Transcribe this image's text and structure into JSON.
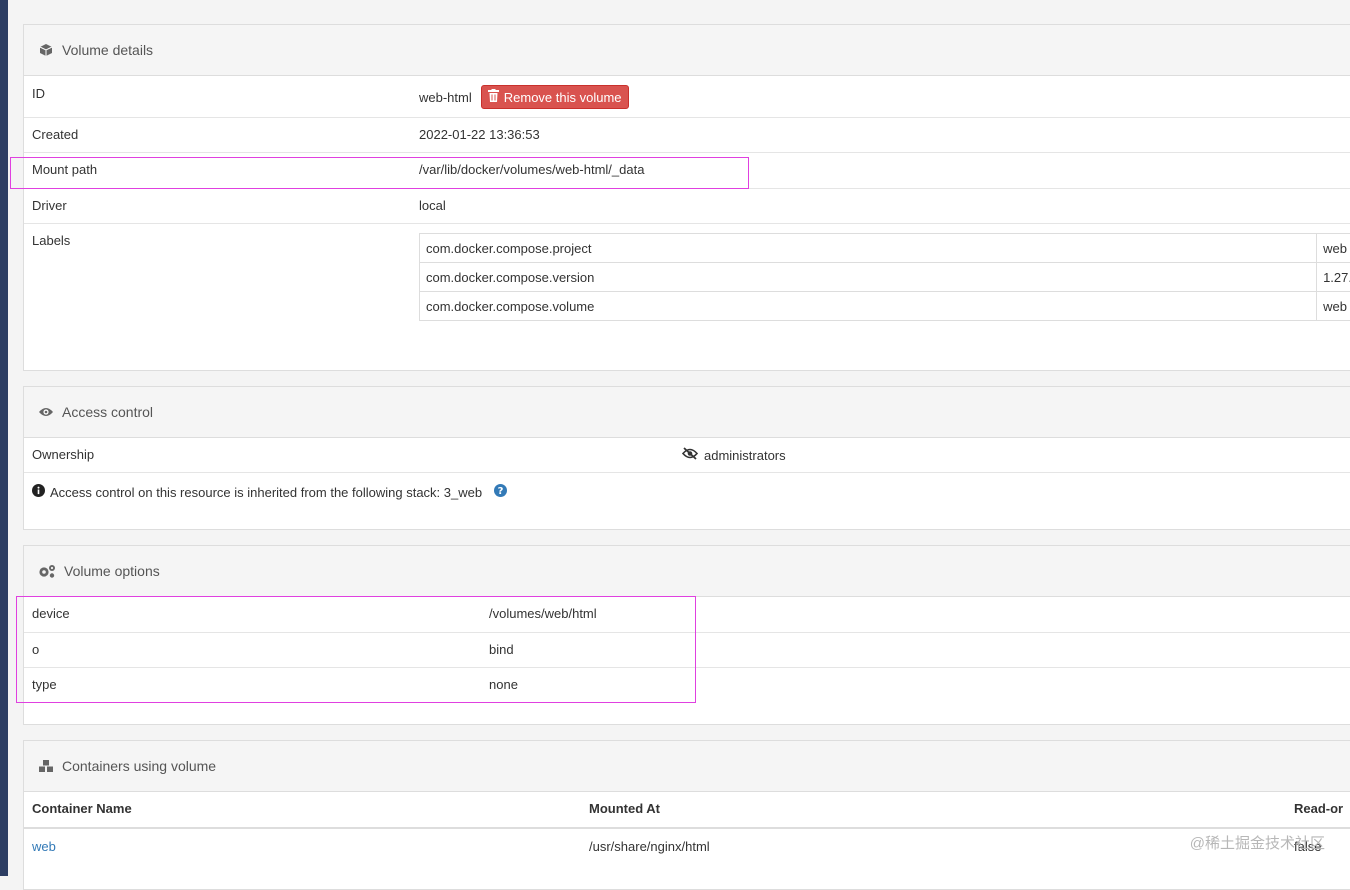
{
  "volume_details": {
    "title": "Volume details",
    "id_label": "ID",
    "id_value": "web-html",
    "remove_button": "Remove this volume",
    "created_label": "Created",
    "created_value": "2022-01-22 13:36:53",
    "mount_label": "Mount path",
    "mount_value": "/var/lib/docker/volumes/web-html/_data",
    "driver_label": "Driver",
    "driver_value": "local",
    "labels_label": "Labels",
    "labels": [
      {
        "key": "com.docker.compose.project",
        "value": "web"
      },
      {
        "key": "com.docker.compose.version",
        "value": "1.27."
      },
      {
        "key": "com.docker.compose.volume",
        "value": "web"
      }
    ]
  },
  "access_control": {
    "title": "Access control",
    "ownership_label": "Ownership",
    "ownership_value": "administrators",
    "inherited_note": "Access control on this resource is inherited from the following stack: 3_web"
  },
  "volume_options": {
    "title": "Volume options",
    "rows": [
      {
        "key": "device",
        "value": "/volumes/web/html"
      },
      {
        "key": "o",
        "value": "bind"
      },
      {
        "key": "type",
        "value": "none"
      }
    ]
  },
  "containers": {
    "title": "Containers using volume",
    "headers": {
      "name": "Container Name",
      "mounted": "Mounted At",
      "readonly": "Read-or"
    },
    "rows": [
      {
        "name": "web",
        "mounted": "/usr/share/nginx/html",
        "readonly": "false"
      }
    ]
  },
  "watermark": "@稀土掘金技术社区",
  "colors": {
    "danger": "#d9534f",
    "link": "#337ab7",
    "highlight": "#e040e0",
    "sidebar": "#2d3e63"
  }
}
